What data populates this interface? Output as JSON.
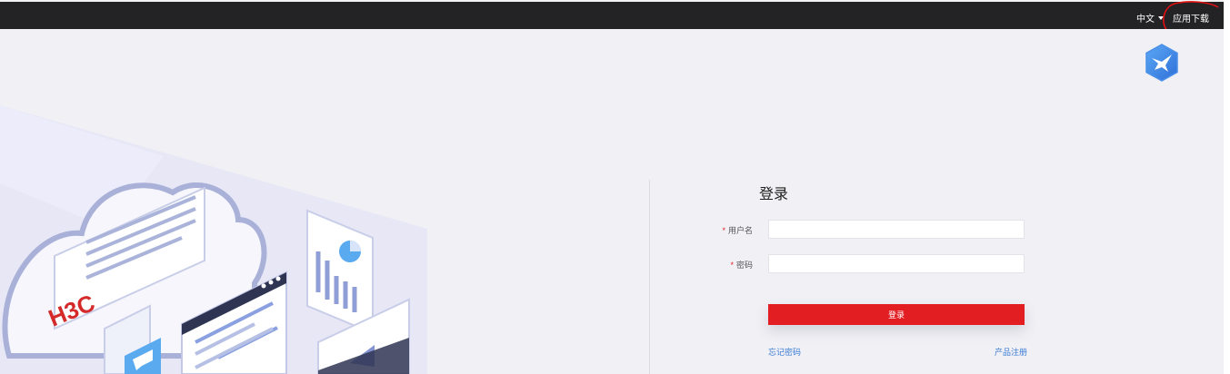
{
  "topbar": {
    "language_label": "中文",
    "app_download_label": "应用下载"
  },
  "logo": {
    "icon": "bird-hexagon-logo"
  },
  "illustration": {
    "brand_text": "H3C"
  },
  "login": {
    "title": "登录",
    "username_label": "用户名",
    "password_label": "密码",
    "required_mark": "*",
    "username_value": "",
    "password_value": "",
    "submit_label": "登录",
    "forgot_password_label": "忘记密码",
    "register_label": "产品注册"
  },
  "colors": {
    "topbar_bg": "#232325",
    "primary_red": "#e21e23",
    "link_blue": "#3a7bd5",
    "page_bg": "#f0f0f5",
    "logo_blue": "#3a8fe8",
    "annotation_red": "#e01010"
  }
}
